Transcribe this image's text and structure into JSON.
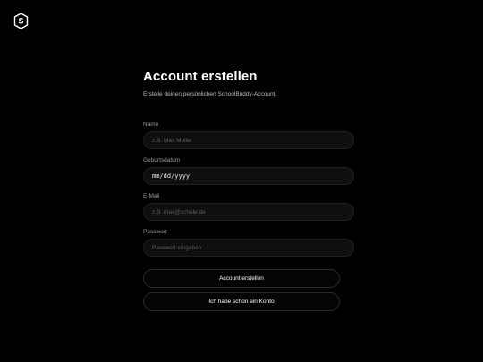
{
  "brand": {
    "logo_icon": "shield-s-logo-icon",
    "logo_letter": "S"
  },
  "form": {
    "title": "Account erstellen",
    "subtitle": "Erstelle deinen persönlichen SchoolBuddy-Account.",
    "fields": {
      "name": {
        "label": "Name",
        "placeholder": "z.B. Max Müller"
      },
      "birthdate": {
        "label": "Geburtsdatum",
        "value": "mm/dd/yyyy"
      },
      "email": {
        "label": "E-Mail",
        "placeholder": "z.B. max@schule.de"
      },
      "password": {
        "label": "Passwort",
        "placeholder": "Passwort eingeben"
      }
    },
    "buttons": {
      "create": "Account erstellen",
      "have_account": "Ich habe schon ein Konto"
    }
  },
  "colors": {
    "background": "#000000",
    "input_bg": "#0f0f0f",
    "border": "#202020",
    "text": "#ffffff",
    "muted": "#9a9a9a"
  }
}
